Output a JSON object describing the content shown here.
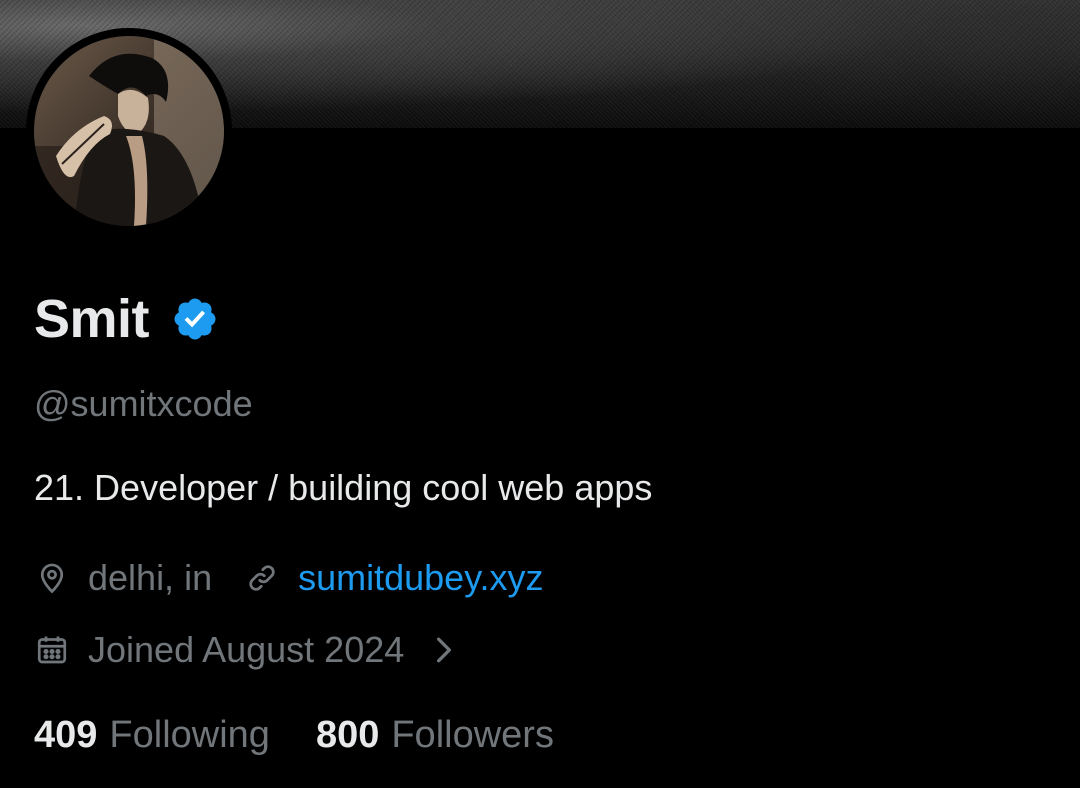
{
  "profile": {
    "display_name": "Smit",
    "verified": true,
    "handle": "@sumitxcode",
    "bio": "21. Developer / building cool web apps",
    "location": "delhi, in",
    "website": "sumitdubey.xyz",
    "joined": "Joined August 2024"
  },
  "stats": {
    "following_count": "409",
    "following_label": "Following",
    "followers_count": "800",
    "followers_label": "Followers"
  },
  "icons": {
    "verified": "verified-badge-icon",
    "location": "map-pin-icon",
    "link": "link-icon",
    "calendar": "calendar-icon",
    "chevron": "chevron-right-icon"
  },
  "colors": {
    "background": "#000000",
    "primary_text": "#e7e9ea",
    "secondary_text": "#71767b",
    "accent": "#1d9bf0"
  }
}
